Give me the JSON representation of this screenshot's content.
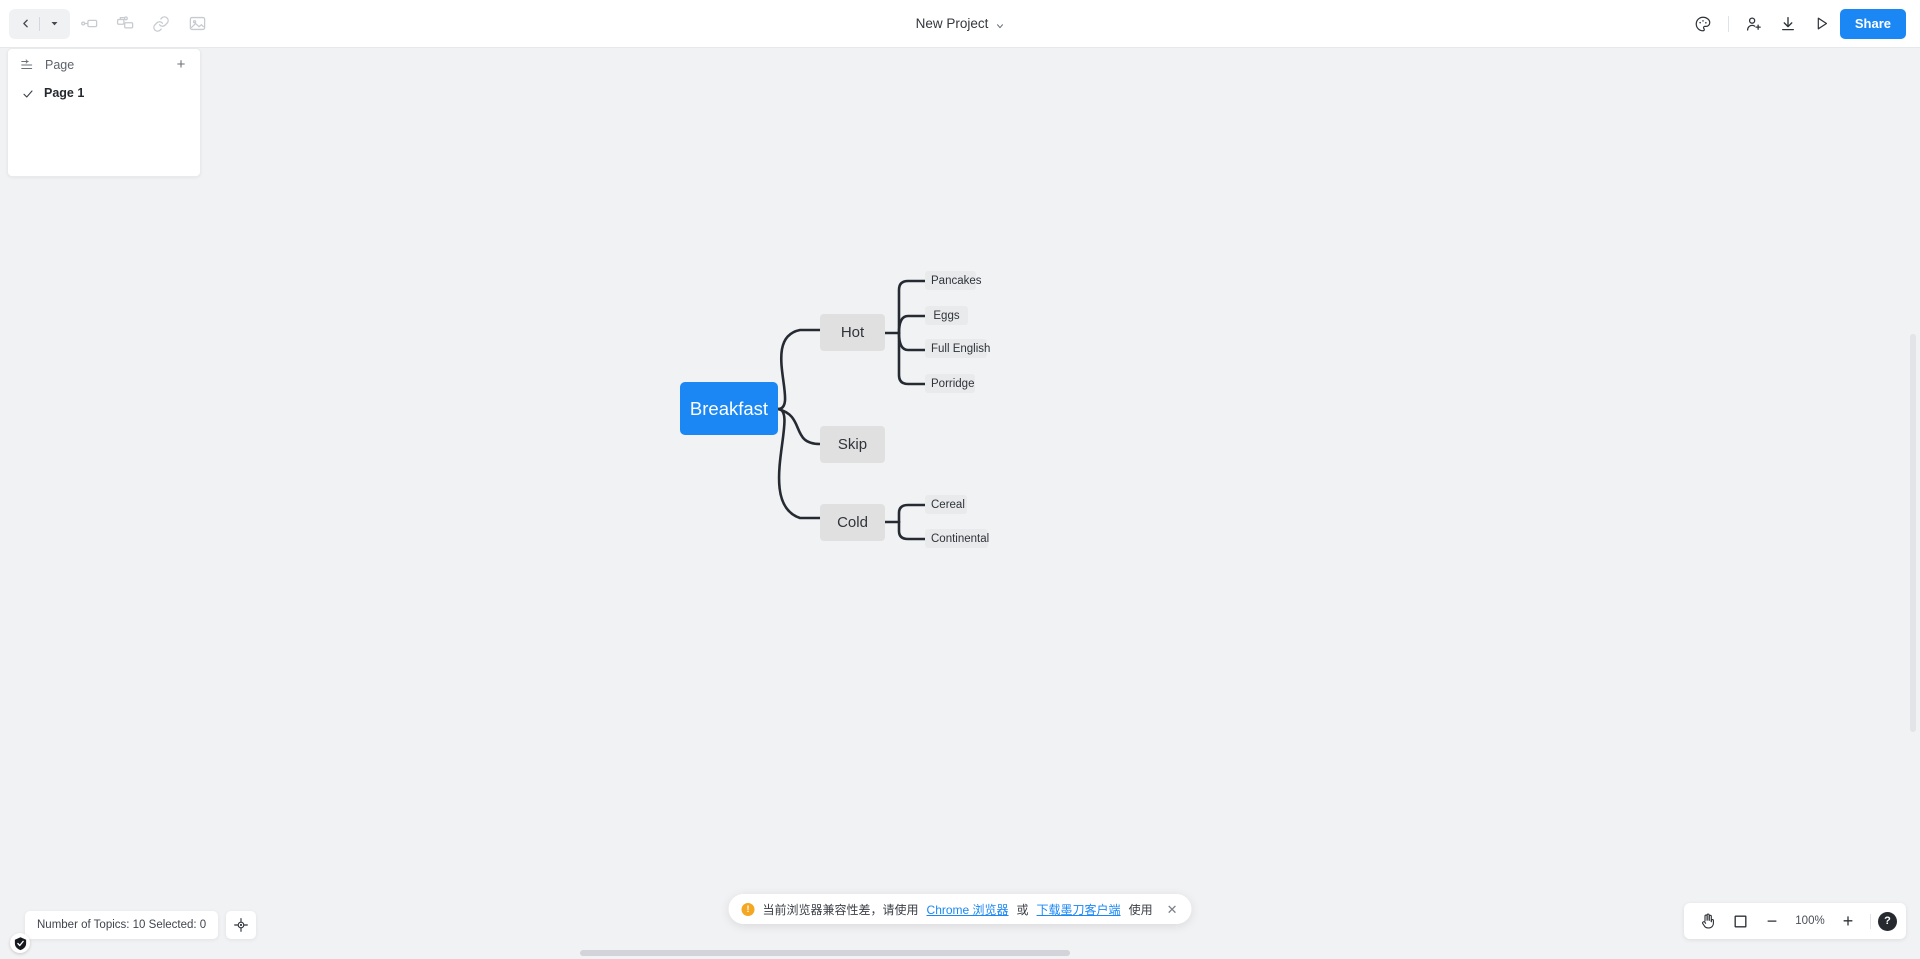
{
  "topbar": {
    "history": {
      "back_icon": "chevron-left-icon",
      "dropdown_icon": "caret-down-icon"
    },
    "tools": [
      {
        "name": "add-sibling-topic-icon",
        "enabled": false
      },
      {
        "name": "add-subtopic-icon",
        "enabled": false
      },
      {
        "name": "link-icon",
        "enabled": false
      },
      {
        "name": "image-icon",
        "enabled": false
      }
    ],
    "project_title": "New Project",
    "right_tools": [
      {
        "name": "theme-palette-icon"
      },
      {
        "name": "invite-user-icon"
      },
      {
        "name": "download-icon"
      },
      {
        "name": "present-play-icon"
      }
    ],
    "share_label": "Share"
  },
  "page_panel": {
    "header_icon": "page-list-icon",
    "header_title": "Page",
    "add_label": "+",
    "items": [
      {
        "label": "Page 1",
        "checked": true
      }
    ]
  },
  "mindmap": {
    "root": {
      "label": "Breakfast",
      "color": "#1a87f5",
      "text_color": "#ffffff"
    },
    "branch_color": "#e0e0e0",
    "leaf_color": "#e9eaeb",
    "line_color": "#262b33",
    "branches": [
      {
        "label": "Hot",
        "children": [
          {
            "label": "Pancakes"
          },
          {
            "label": "Eggs"
          },
          {
            "label": "Full English"
          },
          {
            "label": "Porridge"
          }
        ]
      },
      {
        "label": "Skip",
        "children": []
      },
      {
        "label": "Cold",
        "children": [
          {
            "label": "Cereal"
          },
          {
            "label": "Continental"
          }
        ]
      }
    ]
  },
  "status": {
    "text": "Number of Topics: 10 Selected:  0",
    "fit_icon": "fit-to-screen-crosshair-icon",
    "shield_icon": "shield-check-icon"
  },
  "notification": {
    "warn_icon": "warning-exclamation-icon",
    "text_before": "当前浏览器兼容性差，请使用 ",
    "link1": "Chrome 浏览器",
    "text_middle": "或 ",
    "link2": "下载墨刀客户端",
    "text_after": " 使用",
    "close_icon": "close-x-icon"
  },
  "zoombar": {
    "hand_icon": "hand-pan-icon",
    "frame_icon": "frame-square-icon",
    "minus_label": "−",
    "zoom_level": "100%",
    "plus_label": "+",
    "help_label": "?"
  }
}
